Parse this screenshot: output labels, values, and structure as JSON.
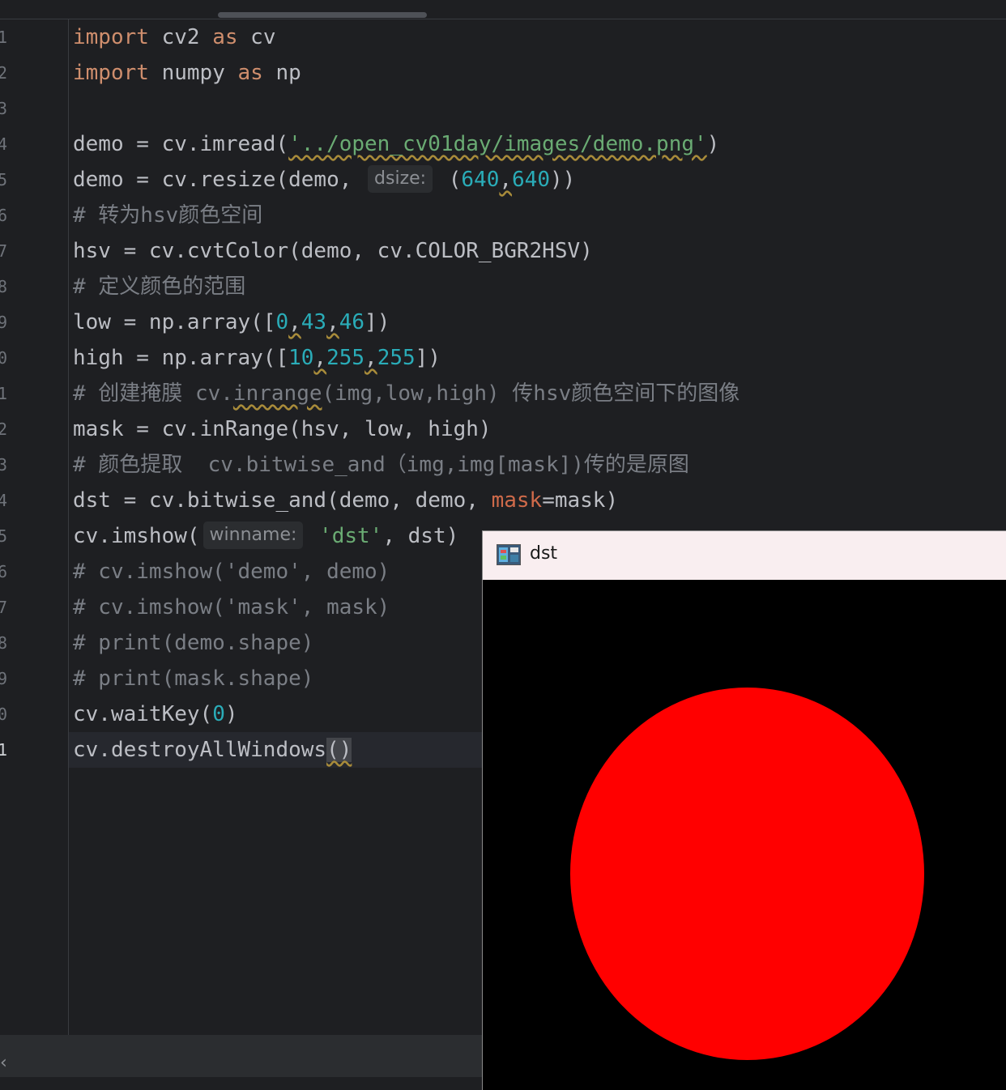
{
  "editor": {
    "line_numbers": [
      "1",
      "2",
      "3",
      "4",
      "5",
      "6",
      "7",
      "8",
      "9",
      "0",
      "1",
      "2",
      "3",
      "4",
      "5",
      "6",
      "7",
      "8",
      "9",
      "0",
      "1"
    ],
    "lines": {
      "l1": {
        "kw1": "import",
        "t1": " cv2 ",
        "kw2": "as",
        "t2": " cv"
      },
      "l2": {
        "kw1": "import",
        "t1": " numpy ",
        "kw2": "as",
        "t2": " np"
      },
      "l4": {
        "t1": "demo = cv.imread(",
        "s1": "'../open_cv01day/images/demo.png'",
        "t2": ")"
      },
      "l5": {
        "t1": "demo = cv.resize(demo, ",
        "hint": "dsize:",
        "t2": " (",
        "n1": "640",
        "t3": ",",
        "n2": "640",
        "t4": "))"
      },
      "l6": {
        "c": "# 转为hsv颜色空间"
      },
      "l7": {
        "t1": "hsv = cv.cvtColor(demo, cv.COLOR_BGR2HSV)"
      },
      "l8": {
        "c": "# 定义颜色的范围"
      },
      "l9": {
        "t1": "low = np.array([",
        "n1": "0",
        "t2": ",",
        "n2": "43",
        "t3": ",",
        "n3": "46",
        "t4": "])"
      },
      "l10": {
        "t1": "high = np.array([",
        "n1": "10",
        "t2": ",",
        "n2": "255",
        "t3": ",",
        "n3": "255",
        "t4": "])"
      },
      "l11": {
        "c1": "# 创建掩膜 cv.",
        "c2": "inrange",
        "c3": "(img,low,high) 传hsv颜色空间下的图像"
      },
      "l12": {
        "t1": "mask = cv.inRange(hsv, low, high)"
      },
      "l13": {
        "c": "# 颜色提取  cv.bitwise_and（img,img[mask])传的是原图"
      },
      "l14": {
        "t1": "dst = cv.bitwise_and(demo, demo, ",
        "p1": "mask",
        "t2": "=mask)"
      },
      "l15": {
        "t1": "cv.imshow(",
        "hint": "winname:",
        "s1": " 'dst'",
        "t2": ", dst)"
      },
      "l16": {
        "c": "# cv.imshow('demo', demo)"
      },
      "l17": {
        "c": "# cv.imshow('mask', mask)"
      },
      "l18": {
        "c": "# print(demo.shape)"
      },
      "l19": {
        "c": "# print(mask.shape)"
      },
      "l20": {
        "t1": "cv.waitKey(",
        "n1": "0",
        "t2": ")"
      },
      "l21": {
        "t1": "cv.destroyAllWindows",
        "t2": "()"
      }
    }
  },
  "window": {
    "title": "dst",
    "titlebar_color": "#f9eef0",
    "circle_color": "#ff0000"
  },
  "colors": {
    "background": "#1e1f22",
    "keyword": "#cf8e6d",
    "string": "#6aab73",
    "number": "#2aacb8",
    "comment": "#7a7e85"
  }
}
